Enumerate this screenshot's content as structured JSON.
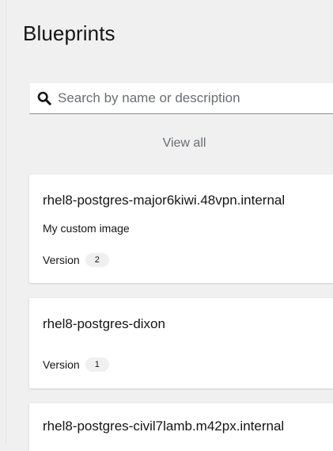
{
  "page": {
    "title": "Blueprints"
  },
  "search": {
    "placeholder": "Search by name or description",
    "value": ""
  },
  "view_all_label": "View all",
  "blueprints": [
    {
      "name": "rhel8-postgres-major6kiwi.48vpn.internal",
      "description": "My custom image",
      "version_label": "Version",
      "version": "2"
    },
    {
      "name": "rhel8-postgres-dixon",
      "description": "",
      "version_label": "Version",
      "version": "1"
    },
    {
      "name": "rhel8-postgres-civil7lamb.m42px.internal"
    }
  ],
  "icons": {
    "search": "search-icon"
  }
}
